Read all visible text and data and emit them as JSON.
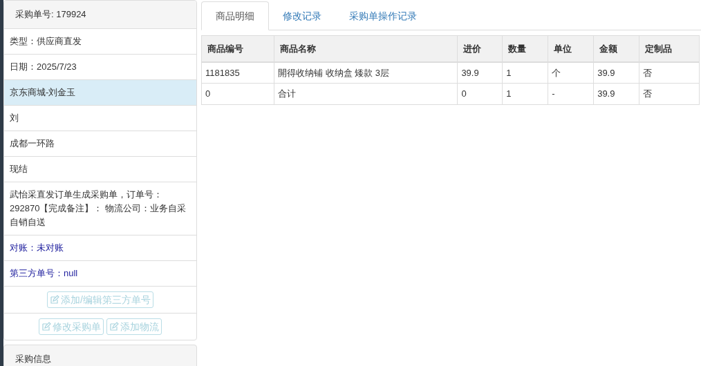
{
  "sidebar": {
    "title": "采购单号: 179924",
    "items": [
      {
        "text": "类型：供应商直发",
        "kind": "text",
        "selected": false
      },
      {
        "text": "日期：2025/7/23",
        "kind": "text",
        "selected": false
      },
      {
        "text": "京东商城-刘金玉",
        "kind": "text",
        "selected": true
      },
      {
        "text": "刘",
        "kind": "text",
        "selected": false
      },
      {
        "text": "成都一环路",
        "kind": "text",
        "selected": false
      },
      {
        "text": "现结",
        "kind": "text",
        "selected": false
      },
      {
        "text": "武怡采直发订单生成采购单，订单号：292870【完成备注】： 物流公司：业务自采自销自送",
        "kind": "text",
        "selected": false
      },
      {
        "text": "对账：未对账",
        "kind": "info",
        "selected": false
      },
      {
        "text": "第三方单号：null",
        "kind": "info",
        "selected": false
      }
    ],
    "button_rows": [
      [
        {
          "label": "添加/编辑第三方单号",
          "disabled": true
        }
      ],
      [
        {
          "label": "修改采购单",
          "disabled": true
        },
        {
          "label": "添加物流",
          "disabled": true
        }
      ]
    ],
    "next_panel_title": "采购信息"
  },
  "tabs": [
    {
      "label": "商品明细",
      "selected": true
    },
    {
      "label": "修改记录",
      "selected": false
    },
    {
      "label": "采购单操作记录",
      "selected": false
    }
  ],
  "table": {
    "columns": [
      "商品编号",
      "商品名称",
      "进价",
      "数量",
      "单位",
      "金额",
      "定制品"
    ],
    "rows": [
      [
        "1181835",
        "開得收纳铺 收纳盒 矮款 3层",
        "39.9",
        "1",
        "个",
        "39.9",
        "否"
      ],
      [
        "0",
        "合计",
        "0",
        "1",
        "-",
        "39.9",
        "否"
      ]
    ]
  }
}
